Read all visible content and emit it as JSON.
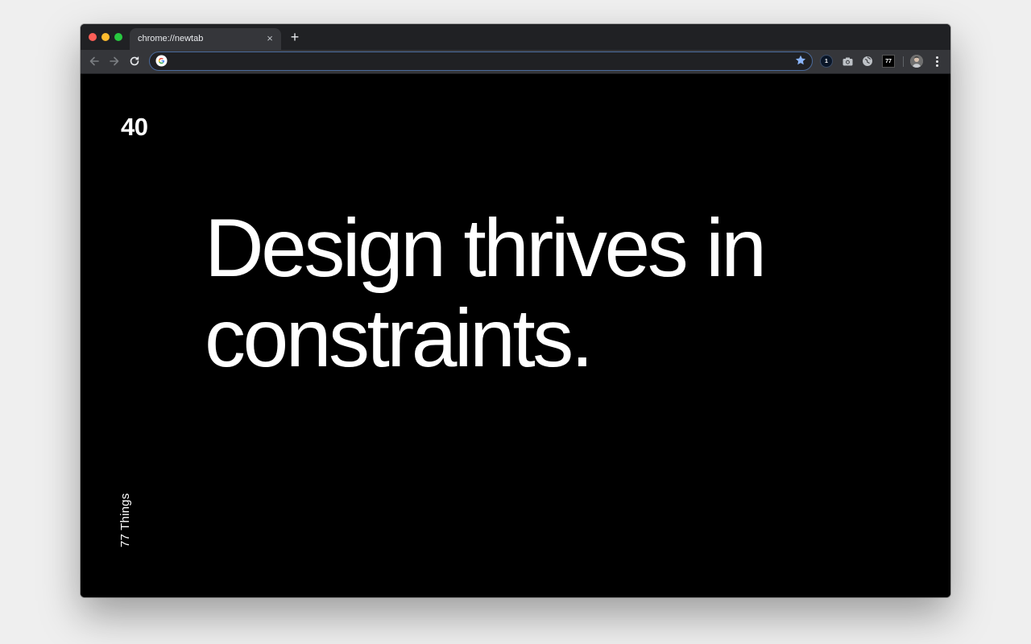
{
  "browser": {
    "tab": {
      "title": "chrome://newtab",
      "close_glyph": "×"
    },
    "new_tab_glyph": "+",
    "toolbar": {
      "back_icon": "arrow-left-icon",
      "forward_icon": "arrow-right-icon",
      "reload_icon": "reload-icon",
      "omnibox": {
        "value": "",
        "placeholder": ""
      },
      "bookmark_icon": "star-icon",
      "extensions": [
        {
          "name": "1password-extension",
          "label": "1"
        },
        {
          "name": "camera-extension",
          "label": ""
        },
        {
          "name": "pocket-extension",
          "label": ""
        },
        {
          "name": "77-things-extension",
          "label": "77"
        }
      ]
    },
    "colors": {
      "tabstrip": "#202124",
      "toolbar": "#35363a",
      "omnibox_border": "#4a6a9c",
      "star": "#8ab4f8"
    }
  },
  "page": {
    "counter": "40",
    "headline": "Design thrives in constraints.",
    "brand_label": "77 Things",
    "background": "#000000",
    "text_color": "#ffffff"
  }
}
